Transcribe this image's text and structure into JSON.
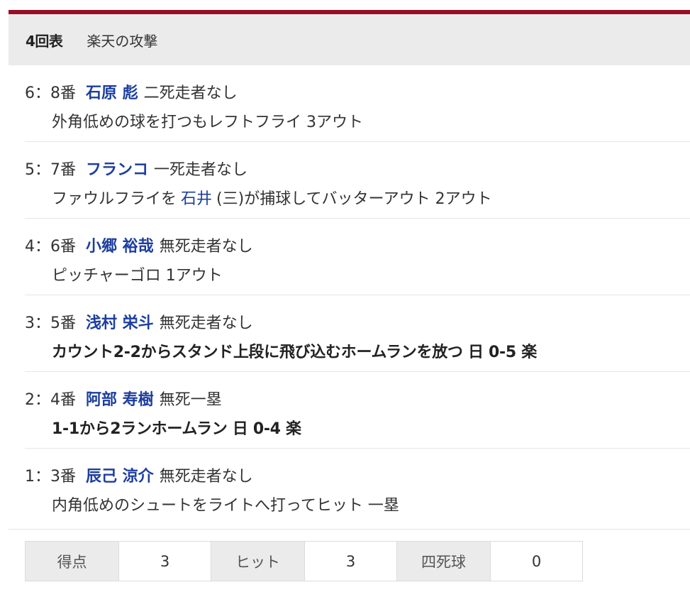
{
  "header": {
    "inning": "4回表",
    "attack": "楽天の攻撃"
  },
  "plays": [
    {
      "prefix": "6：8番",
      "player": "石原 彪",
      "situation": "二死走者なし",
      "desc": "外角低めの球を打つもレフトフライ 3アウト"
    },
    {
      "prefix": "5：7番",
      "player": "フランコ",
      "situation": "一死走者なし",
      "desc_pre": "ファウルフライを",
      "fielder": "石井",
      "desc_post": "(三)が捕球してバッターアウト 2アウト"
    },
    {
      "prefix": "4：6番",
      "player": "小郷 裕哉",
      "situation": "無死走者なし",
      "desc": "ピッチャーゴロ 1アウト"
    },
    {
      "prefix": "3：5番",
      "player": "浅村 栄斗",
      "situation": "無死走者なし",
      "desc": "カウント2-2からスタンド上段に飛び込むホームランを放つ 日 0-5 楽"
    },
    {
      "prefix": "2：4番",
      "player": "阿部 寿樹",
      "situation": "無死一塁",
      "desc": "1-1から2ランホームラン 日 0-4 楽"
    },
    {
      "prefix": "1：3番",
      "player": "辰己 涼介",
      "situation": "無死走者なし",
      "desc": "内角低めのシュートをライトへ打ってヒット 一塁"
    }
  ],
  "stats": {
    "runs_label": "得点",
    "runs": "3",
    "hits_label": "ヒット",
    "hits": "3",
    "walks_label": "四死球",
    "walks": "0"
  },
  "colors": {
    "accent_bar": "#9a0d26",
    "player_link": "#1d3e9e",
    "header_bg": "#ebebeb"
  }
}
